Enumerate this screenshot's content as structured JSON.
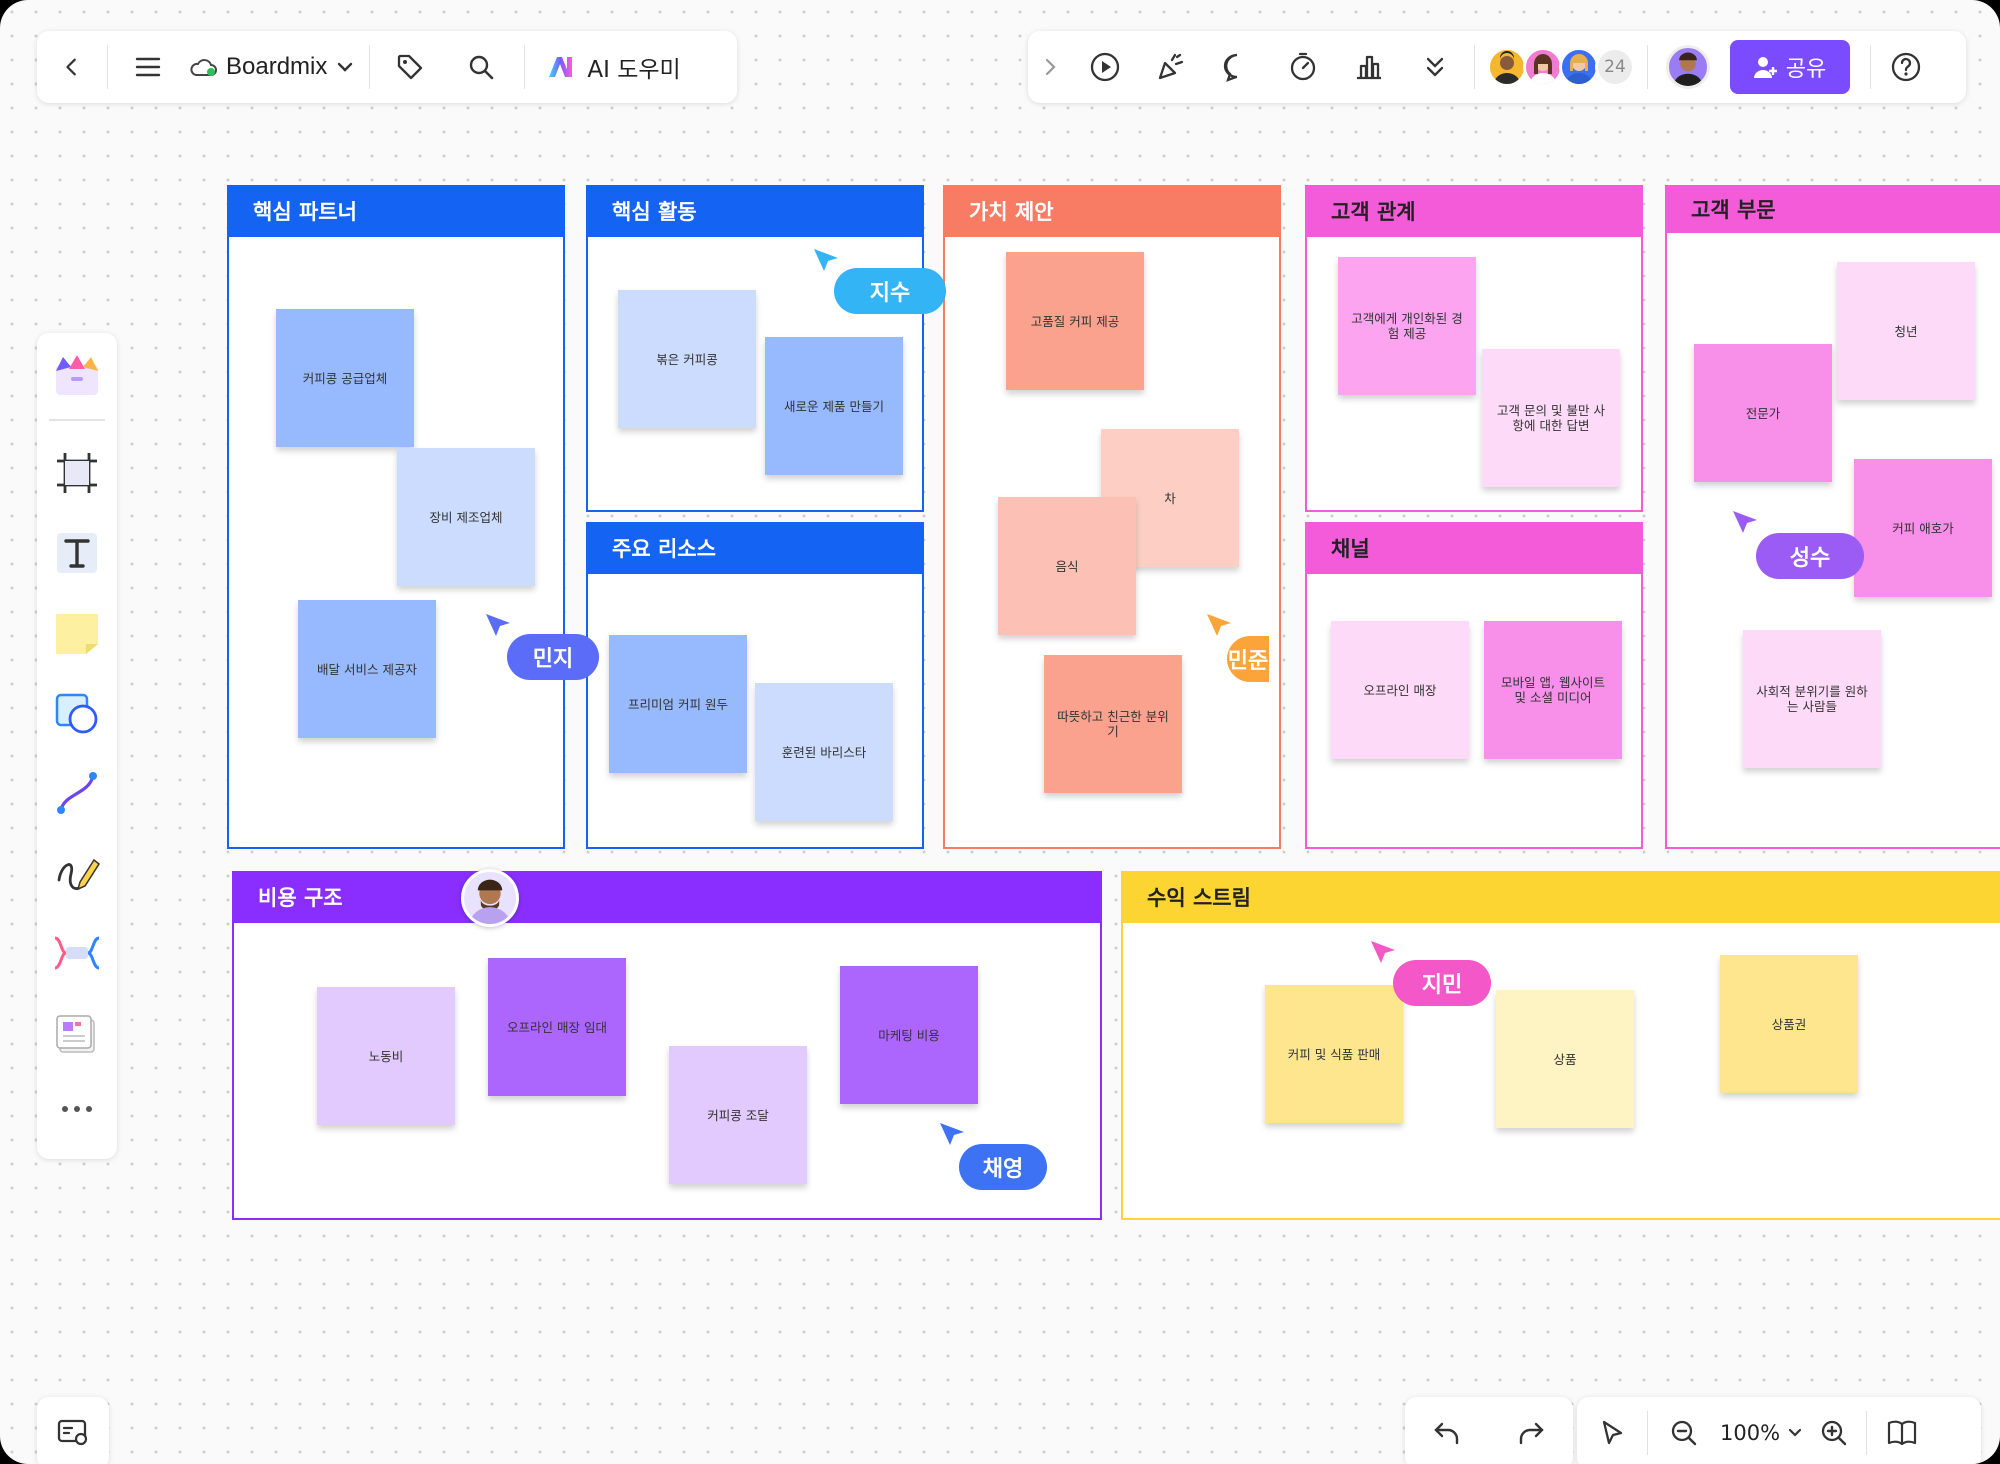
{
  "app": {
    "name": "Boardmix",
    "ai_label": "AI 도우미"
  },
  "toolbar_right": {
    "collaborator_count": "24",
    "share_label": "공유"
  },
  "zoom": {
    "level": "100%"
  },
  "frames": {
    "key_partners": {
      "title": "핵심 파트너",
      "notes": [
        "커피콩 공급업체",
        "장비 제조업체",
        "배달 서비스 제공자"
      ]
    },
    "key_activities": {
      "title": "핵심 활동",
      "notes": [
        "볶은 커피콩",
        "새로운 제품 만들기"
      ]
    },
    "key_resources": {
      "title": "주요 리소스",
      "notes": [
        "프리미엄 커피 원두",
        "훈련된 바리스타"
      ]
    },
    "value_propositions": {
      "title": "가치 제안",
      "notes": [
        "고품질 커피 제공",
        "차",
        "음식",
        "따뜻하고 친근한 분위기"
      ]
    },
    "customer_relationships": {
      "title": "고객 관계",
      "notes": [
        "고객에게 개인화된 경험 제공",
        "고객 문의 및 불만 사항에 대한 답변"
      ]
    },
    "channels": {
      "title": "채널",
      "notes": [
        "오프라인 매장",
        "모바일 앱, 웹사이트 및 소셜 미디어"
      ]
    },
    "customer_segments": {
      "title": "고객 부문",
      "notes": [
        "청년",
        "전문가",
        "커피 애호가",
        "사회적 분위기를 원하는 사람들"
      ]
    },
    "cost_structure": {
      "title": "비용 구조",
      "notes": [
        "노동비",
        "오프라인 매장 임대",
        "커피콩 조달",
        "마케팅 비용"
      ]
    },
    "revenue_streams": {
      "title": "수익 스트림",
      "notes": [
        "커피 및 식품 판매",
        "상품",
        "상품권"
      ]
    }
  },
  "cursors": [
    "지수",
    "민지",
    "민준",
    "성수",
    "지민",
    "채영"
  ],
  "colors": {
    "blue": "#1463f3",
    "sky": "#32b4f5",
    "coral": "#f87c64",
    "pink": "#f35bd8",
    "purple": "#8a2eff",
    "yellow": "#fdd532",
    "share": "#7b4cff"
  }
}
